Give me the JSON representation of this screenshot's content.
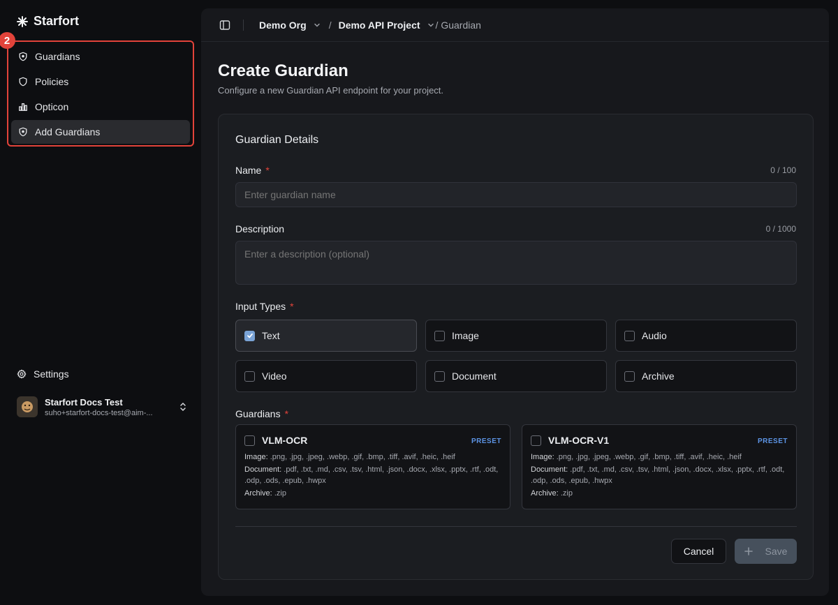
{
  "sidebar": {
    "brand": "Starfort",
    "highlight_badge": "2",
    "nav": [
      {
        "label": "Guardians",
        "icon": "shield-icon"
      },
      {
        "label": "Policies",
        "icon": "shield-icon"
      },
      {
        "label": "Opticon",
        "icon": "bar-chart-icon"
      },
      {
        "label": "Add Guardians",
        "icon": "shield-icon",
        "active": true
      }
    ],
    "settings_label": "Settings",
    "user": {
      "name": "Starfort Docs Test",
      "email": "suho+starfort-docs-test@aim-..."
    }
  },
  "breadcrumb": {
    "org": "Demo Org",
    "project": "Demo API Project",
    "page": "/ Guardian",
    "slash": "/"
  },
  "page": {
    "title": "Create Guardian",
    "subtitle": "Configure a new Guardian API endpoint for your project."
  },
  "form": {
    "section_title": "Guardian Details",
    "name": {
      "label": "Name",
      "required_mark": "*",
      "counter": "0 / 100",
      "placeholder": "Enter guardian name",
      "value": ""
    },
    "description": {
      "label": "Description",
      "counter": "0 / 1000",
      "placeholder": "Enter a description (optional)",
      "value": ""
    },
    "input_types": {
      "label": "Input Types",
      "required_mark": "*",
      "options": [
        {
          "label": "Text",
          "checked": true
        },
        {
          "label": "Image",
          "checked": false
        },
        {
          "label": "Audio",
          "checked": false
        },
        {
          "label": "Video",
          "checked": false
        },
        {
          "label": "Document",
          "checked": false
        },
        {
          "label": "Archive",
          "checked": false
        }
      ]
    },
    "guardians": {
      "label": "Guardians",
      "required_mark": "*",
      "items": [
        {
          "name": "VLM-OCR",
          "tag": "PRESET",
          "checked": false,
          "image_key": "Image:",
          "image": ".png, .jpg, .jpeg, .webp, .gif, .bmp, .tiff, .avif, .heic, .heif",
          "document_key": "Document:",
          "document": ".pdf, .txt, .md, .csv, .tsv, .html, .json, .docx, .xlsx, .pptx, .rtf, .odt, .odp, .ods, .epub, .hwpx",
          "archive_key": "Archive:",
          "archive": ".zip"
        },
        {
          "name": "VLM-OCR-V1",
          "tag": "PRESET",
          "checked": false,
          "image_key": "Image:",
          "image": ".png, .jpg, .jpeg, .webp, .gif, .bmp, .tiff, .avif, .heic, .heif",
          "document_key": "Document:",
          "document": ".pdf, .txt, .md, .csv, .tsv, .html, .json, .docx, .xlsx, .pptx, .rtf, .odt, .odp, .ods, .epub, .hwpx",
          "archive_key": "Archive:",
          "archive": ".zip"
        }
      ]
    },
    "buttons": {
      "cancel": "Cancel",
      "save": "Save"
    }
  },
  "colors": {
    "accent_red": "#e2433a",
    "checkbox_blue": "#7aa3d6",
    "preset_blue": "#5d95e6"
  }
}
